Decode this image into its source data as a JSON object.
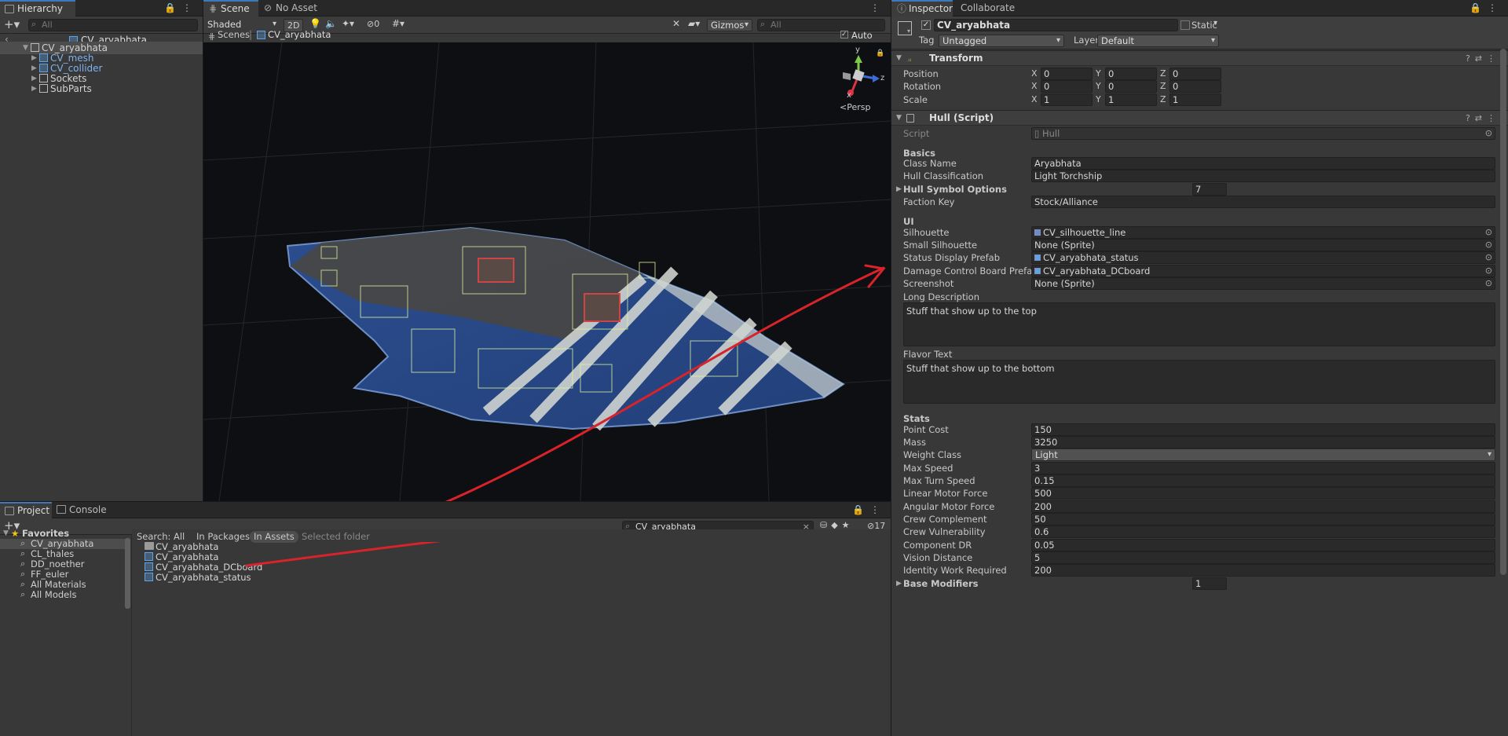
{
  "hierarchy": {
    "tab": "Hierarchy",
    "search_placeholder": "All",
    "breadcrumb": "CV_aryabhata",
    "root": "CV_aryabhata",
    "children": [
      "CV_mesh",
      "CV_collider",
      "Sockets",
      "SubParts"
    ]
  },
  "scene": {
    "tabs": [
      "Scene",
      "No Asset"
    ],
    "shading": "Shaded",
    "btn_2d": "2D",
    "hidden_count": "0",
    "gizmos": "Gizmos",
    "search_placeholder": "All",
    "breadcrumb_root": "Scenes",
    "breadcrumb_item": "CV_aryabhata",
    "auto_save": "Auto Save",
    "gizmo_y": "y",
    "gizmo_z": "z",
    "gizmo_x": "x",
    "persp": "Persp"
  },
  "project": {
    "tabs": [
      "Project",
      "Console"
    ],
    "search_value": "CV_aryabhata",
    "hidden_count": "17",
    "favorites_label": "Favorites",
    "favorites": [
      "CV_aryabhata",
      "CL_thales",
      "DD_noether",
      "FF_euler",
      "All Materials",
      "All Models"
    ],
    "search_label": "Search:",
    "filters": [
      "All",
      "In Packages",
      "In Assets",
      "Selected folder"
    ],
    "assets": [
      "CV_aryabhata",
      "CV_aryabhata",
      "CV_aryabhata_DCboard",
      "CV_aryabhata_status"
    ]
  },
  "inspector": {
    "tabs": [
      "Inspector",
      "Collaborate"
    ],
    "object_name": "CV_aryabhata",
    "static_label": "Static",
    "tag_label": "Tag",
    "tag_value": "Untagged",
    "layer_label": "Layer",
    "layer_value": "Default",
    "transform": {
      "title": "Transform",
      "rows": [
        {
          "label": "Position",
          "x": "0",
          "y": "0",
          "z": "0"
        },
        {
          "label": "Rotation",
          "x": "0",
          "y": "0",
          "z": "0"
        },
        {
          "label": "Scale",
          "x": "1",
          "y": "1",
          "z": "1"
        }
      ]
    },
    "hull": {
      "title": "Hull (Script)",
      "script_label": "Script",
      "script_value": "Hull",
      "basics": "Basics",
      "class_name_label": "Class Name",
      "class_name": "Aryabhata",
      "hull_class_label": "Hull Classification",
      "hull_class": "Light Torchship",
      "symbol_label": "Hull Symbol Options",
      "symbol_count": "7",
      "faction_label": "Faction Key",
      "faction": "Stock/Alliance",
      "ui": "UI",
      "silhouette_label": "Silhouette",
      "silhouette": "CV_silhouette_line",
      "small_sil_label": "Small Silhouette",
      "small_sil": "None (Sprite)",
      "status_label": "Status Display Prefab",
      "status": "CV_aryabhata_status",
      "dcb_label": "Damage Control Board Prefab",
      "dcb": "CV_aryabhata_DCboard",
      "screenshot_label": "Screenshot",
      "screenshot": "None (Sprite)",
      "long_desc_label": "Long Description",
      "long_desc": "Stuff that show up to the top",
      "flavor_label": "Flavor Text",
      "flavor": "Stuff that show up to the bottom",
      "stats": "Stats",
      "stat_rows": [
        {
          "label": "Point Cost",
          "value": "150"
        },
        {
          "label": "Mass",
          "value": "3250"
        },
        {
          "label": "Weight Class",
          "value": "Light"
        },
        {
          "label": "Max Speed",
          "value": "3"
        },
        {
          "label": "Max Turn Speed",
          "value": "0.15"
        },
        {
          "label": "Linear Motor Force",
          "value": "500"
        },
        {
          "label": "Angular Motor Force",
          "value": "200"
        },
        {
          "label": "Crew Complement",
          "value": "50"
        },
        {
          "label": "Crew Vulnerability",
          "value": "0.6"
        },
        {
          "label": "Component DR",
          "value": "0.05"
        },
        {
          "label": "Vision Distance",
          "value": "5"
        },
        {
          "label": "Identity Work Required",
          "value": "200"
        }
      ],
      "base_mod_label": "Base Modifiers",
      "base_mod_count": "1"
    }
  },
  "colors": {
    "accent": "#3a79bb",
    "annotation": "#d8232a",
    "hull_blue": "#2a4d8f"
  }
}
